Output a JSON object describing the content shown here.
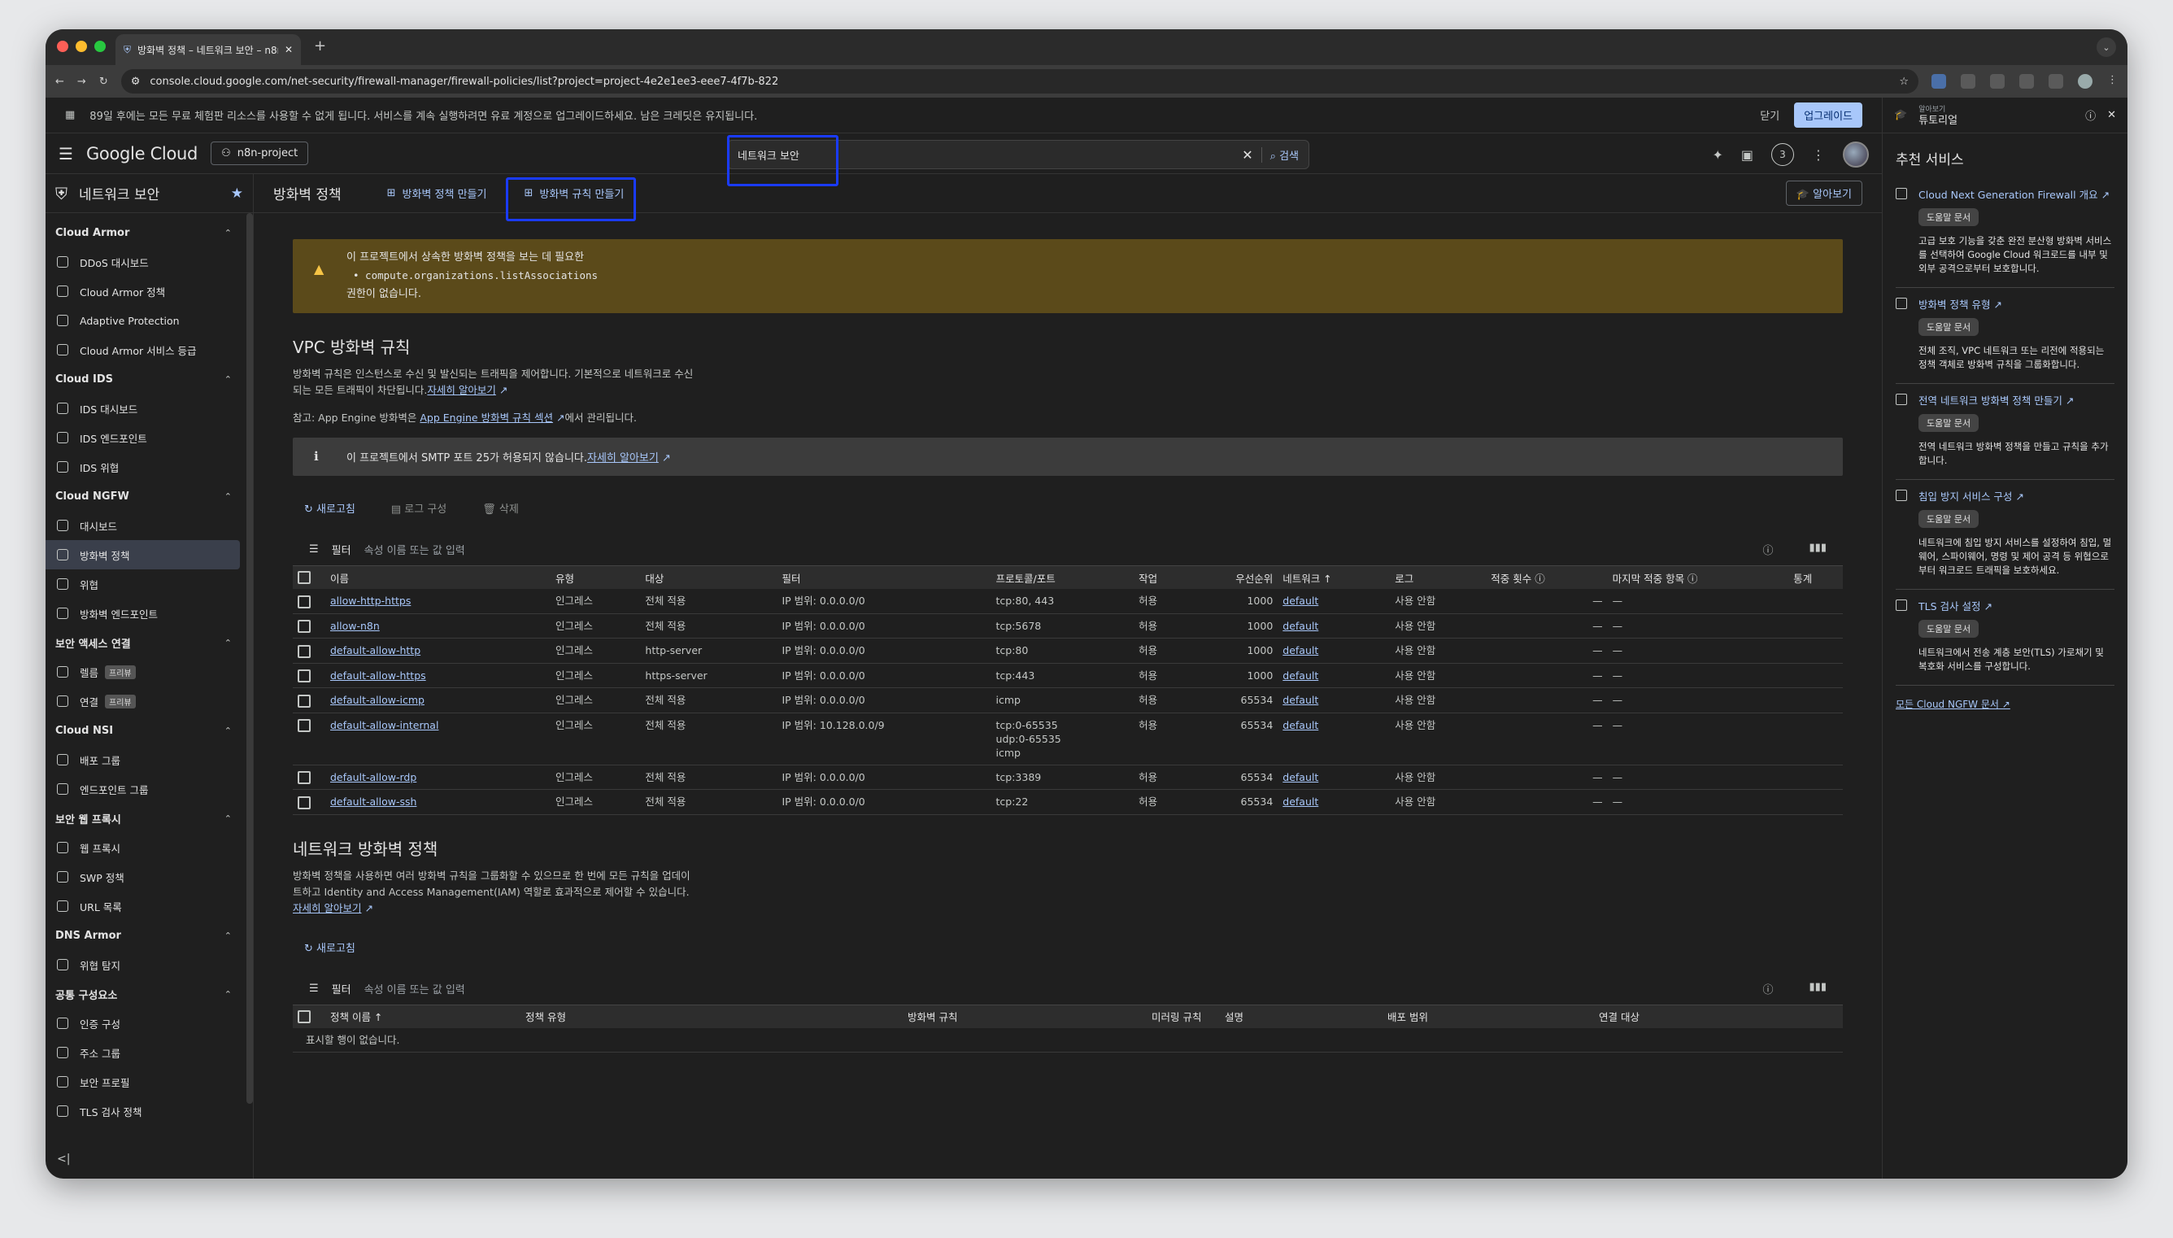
{
  "browser": {
    "tab_title": "방화벽 정책 – 네트워크 보안 – n8n",
    "url": "console.cloud.google.com/net-security/firewall-manager/firewall-policies/list?project=project-4e2e1ee3-eee7-4f7b-822"
  },
  "trial_banner": {
    "message": "89일 후에는 모든 무료 체험판 리소스를 사용할 수 없게 됩니다. 서비스를 계속 실행하려면 유료 계정으로 업그레이드하세요. 남은 크레딧은 유지됩니다.",
    "close_label": "닫기",
    "upgrade_label": "업그레이드"
  },
  "header": {
    "logo": "Google Cloud",
    "project": "n8n-project",
    "search_value": "네트워크 보안",
    "search_button": "검색",
    "notification_count": "3"
  },
  "sidebar": {
    "title": "네트워크 보안",
    "groups": [
      {
        "label": "Cloud Armor",
        "items": [
          {
            "label": "DDoS 대시보드"
          },
          {
            "label": "Cloud Armor 정책"
          },
          {
            "label": "Adaptive Protection"
          },
          {
            "label": "Cloud Armor 서비스 등급"
          }
        ]
      },
      {
        "label": "Cloud IDS",
        "items": [
          {
            "label": "IDS 대시보드"
          },
          {
            "label": "IDS 엔드포인트"
          },
          {
            "label": "IDS 위협"
          }
        ]
      },
      {
        "label": "Cloud NGFW",
        "items": [
          {
            "label": "대시보드"
          },
          {
            "label": "방화벽 정책"
          },
          {
            "label": "위협"
          },
          {
            "label": "방화벽 엔드포인트"
          }
        ]
      },
      {
        "label": "보안 액세스 연결",
        "items": [
          {
            "label": "렐름",
            "badge": "프리뷰"
          },
          {
            "label": "연결",
            "badge": "프리뷰"
          }
        ]
      },
      {
        "label": "Cloud NSI",
        "items": [
          {
            "label": "배포 그룹"
          },
          {
            "label": "엔드포인트 그룹"
          }
        ]
      },
      {
        "label": "보안 웹 프록시",
        "items": [
          {
            "label": "웹 프록시"
          },
          {
            "label": "SWP 정책"
          },
          {
            "label": "URL 목록"
          }
        ]
      },
      {
        "label": "DNS Armor",
        "items": [
          {
            "label": "위협 탐지"
          }
        ]
      },
      {
        "label": "공통 구성요소",
        "items": [
          {
            "label": "인증 구성"
          },
          {
            "label": "주소 그룹"
          },
          {
            "label": "보안 프로필"
          },
          {
            "label": "TLS 검사 정책"
          }
        ]
      }
    ],
    "collapse_glyph": "<|"
  },
  "page": {
    "title": "방화벽 정책",
    "create_policy": "방화벽 정책 만들기",
    "create_rule": "방화벽 규칙 만들기",
    "learn": "알아보기"
  },
  "warning": {
    "line1": "이 프로젝트에서 상속한 방화벽 정책을 보는 데 필요한",
    "line2": "• compute.organizations.listAssociations",
    "line3": "권한이 없습니다."
  },
  "vpc": {
    "heading": "VPC 방화벽 규칙",
    "desc1": "방화벽 규칙은 인스턴스로 수신 및 발신되는 트래픽을 제어합니다. 기본적으로 네트워크로 수신",
    "desc2": "되는 모든 트래픽이 차단됩니다.",
    "learn_more": "자세히 알아보기",
    "note_prefix": "참고: App Engine 방화벽은 ",
    "note_link": "App Engine 방화벽 규칙 섹션",
    "note_suffix": "에서 관리됩니다.",
    "smtp_info": "이 프로젝트에서 SMTP 포트 25가 허용되지 않습니다.",
    "smtp_link": "자세히 알아보기",
    "refresh": "새로고침",
    "log_config": "로그 구성",
    "delete": "삭제",
    "filter_label": "필터",
    "filter_placeholder": "속성 이름 또는 값 입력",
    "columns": [
      "이름",
      "유형",
      "대상",
      "필터",
      "프로토콜/포트",
      "작업",
      "우선순위",
      "네트워크 ↑",
      "로그",
      "적중 횟수 ⓘ",
      "마지막 적중 항목 ⓘ",
      "통계"
    ],
    "rows": [
      {
        "name": "allow-http-https",
        "type": "인그레스",
        "target": "전체 적용",
        "filter": "IP 범위: 0.0.0.0/0",
        "proto": [
          "tcp:80, 443"
        ],
        "action": "허용",
        "priority": "1000",
        "network": "default",
        "log": "사용 안함",
        "hits": "—",
        "last": "—"
      },
      {
        "name": "allow-n8n",
        "type": "인그레스",
        "target": "전체 적용",
        "filter": "IP 범위: 0.0.0.0/0",
        "proto": [
          "tcp:5678"
        ],
        "action": "허용",
        "priority": "1000",
        "network": "default",
        "log": "사용 안함",
        "hits": "—",
        "last": "—"
      },
      {
        "name": "default-allow-http",
        "type": "인그레스",
        "target": "http-server",
        "filter": "IP 범위: 0.0.0.0/0",
        "proto": [
          "tcp:80"
        ],
        "action": "허용",
        "priority": "1000",
        "network": "default",
        "log": "사용 안함",
        "hits": "—",
        "last": "—"
      },
      {
        "name": "default-allow-https",
        "type": "인그레스",
        "target": "https-server",
        "filter": "IP 범위: 0.0.0.0/0",
        "proto": [
          "tcp:443"
        ],
        "action": "허용",
        "priority": "1000",
        "network": "default",
        "log": "사용 안함",
        "hits": "—",
        "last": "—"
      },
      {
        "name": "default-allow-icmp",
        "type": "인그레스",
        "target": "전체 적용",
        "filter": "IP 범위: 0.0.0.0/0",
        "proto": [
          "icmp"
        ],
        "action": "허용",
        "priority": "65534",
        "network": "default",
        "log": "사용 안함",
        "hits": "—",
        "last": "—"
      },
      {
        "name": "default-allow-internal",
        "type": "인그레스",
        "target": "전체 적용",
        "filter": "IP 범위: 10.128.0.0/9",
        "proto": [
          "tcp:0-65535",
          "udp:0-65535",
          "icmp"
        ],
        "action": "허용",
        "priority": "65534",
        "network": "default",
        "log": "사용 안함",
        "hits": "—",
        "last": "—"
      },
      {
        "name": "default-allow-rdp",
        "type": "인그레스",
        "target": "전체 적용",
        "filter": "IP 범위: 0.0.0.0/0",
        "proto": [
          "tcp:3389"
        ],
        "action": "허용",
        "priority": "65534",
        "network": "default",
        "log": "사용 안함",
        "hits": "—",
        "last": "—"
      },
      {
        "name": "default-allow-ssh",
        "type": "인그레스",
        "target": "전체 적용",
        "filter": "IP 범위: 0.0.0.0/0",
        "proto": [
          "tcp:22"
        ],
        "action": "허용",
        "priority": "65534",
        "network": "default",
        "log": "사용 안함",
        "hits": "—",
        "last": "—"
      }
    ]
  },
  "netpol": {
    "heading": "네트워크 방화벽 정책",
    "desc1": "방화벽 정책을 사용하면 여러 방화벽 규칙을 그룹화할 수 있으므로 한 번에 모든 규칙을 업데이",
    "desc2": "트하고 Identity and Access Management(IAM) 역할로 효과적으로 제어할 수 있습니다.",
    "learn_more": "자세히 알아보기",
    "refresh": "새로고침",
    "filter_label": "필터",
    "filter_placeholder": "속성 이름 또는 값 입력",
    "columns": [
      "정책 이름 ↑",
      "정책 유형",
      "방화벽 규칙",
      "미러링 규칙",
      "설명",
      "배포 범위",
      "연결 대상"
    ],
    "empty": "표시할 행이 없습니다."
  },
  "right_panel": {
    "subtitle": "알아보기",
    "title": "튜토리얼",
    "heading": "추천 서비스",
    "chip": "도움말 문서",
    "items": [
      {
        "title": "Cloud Next Generation Firewall 개요",
        "desc": "고급 보호 기능을 갖춘 완전 분산형 방화벽 서비스를 선택하여 Google Cloud 워크로드를 내부 및 외부 공격으로부터 보호합니다."
      },
      {
        "title": "방화벽 정책 유형",
        "desc": "전체 조직, VPC 네트워크 또는 리전에 적용되는 정책 객체로 방화벽 규칙을 그룹화합니다."
      },
      {
        "title": "전역 네트워크 방화벽 정책 만들기",
        "desc": "전역 네트워크 방화벽 정책을 만들고 규칙을 추가합니다."
      },
      {
        "title": "침입 방지 서비스 구성",
        "desc": "네트워크에 침입 방지 서비스를 설정하여 침입, 멀웨어, 스파이웨어, 명령 및 제어 공격 등 위협으로부터 워크로드 트래픽을 보호하세요."
      },
      {
        "title": "TLS 검사 설정",
        "desc": "네트워크에서 전송 계층 보안(TLS) 가로채기 및 복호화 서비스를 구성합니다."
      }
    ],
    "all_docs": "모든 Cloud NGFW 문서"
  }
}
